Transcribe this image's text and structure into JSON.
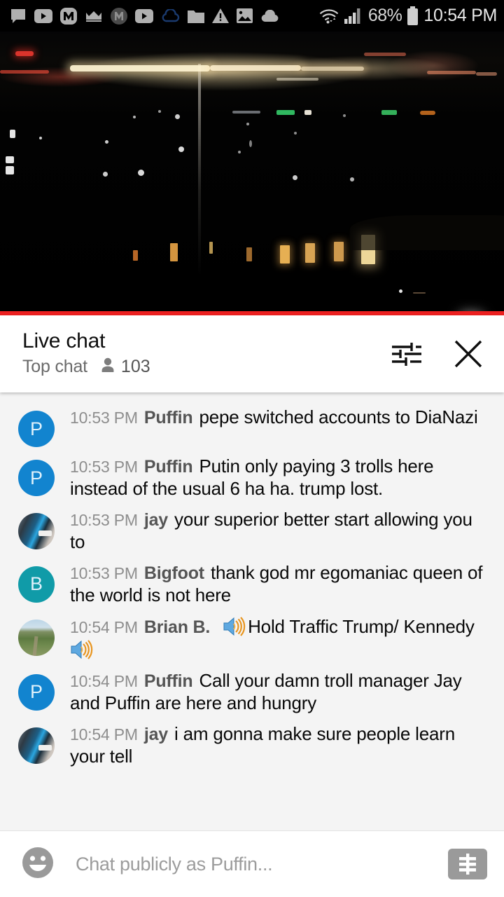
{
  "status_bar": {
    "icons": [
      {
        "name": "messages-icon"
      },
      {
        "name": "youtube-icon"
      },
      {
        "name": "m-badge-icon"
      },
      {
        "name": "crown-icon"
      },
      {
        "name": "m-circle-dark-icon"
      },
      {
        "name": "youtube-second-icon"
      },
      {
        "name": "cloud-outline-icon"
      },
      {
        "name": "folder-icon"
      },
      {
        "name": "warning-triangle-icon"
      },
      {
        "name": "image-icon"
      },
      {
        "name": "cloud-filled-icon"
      }
    ],
    "wifi_icon": "wifi-icon",
    "signal_icon": "cellular-signal-icon",
    "battery_percent": "68%",
    "battery_icon": "battery-icon",
    "clock": "10:54 PM"
  },
  "video": {
    "name": "live-video-player",
    "progress_percent": 100,
    "progress_color": "#ec2020"
  },
  "chat_header": {
    "title": "Live chat",
    "subtitle": "Top chat",
    "viewer_icon": "person-icon",
    "viewer_count": "103",
    "settings_icon": "tune-sliders-icon",
    "close_icon": "close-x-icon"
  },
  "messages": [
    {
      "avatar_type": "initial",
      "avatar_letter": "P",
      "avatar_color": "#1284cf",
      "timestamp": "10:53 PM",
      "author": "Puffin",
      "text": "pepe switched accounts to DiaNazi",
      "emoji": []
    },
    {
      "avatar_type": "initial",
      "avatar_letter": "P",
      "avatar_color": "#1284cf",
      "timestamp": "10:53 PM",
      "author": "Puffin",
      "text": "Putin only paying 3 trolls here instead of the usual 6 ha ha. trump lost.",
      "emoji": []
    },
    {
      "avatar_type": "photo-jay",
      "avatar_letter": "",
      "avatar_color": "#3a4a55",
      "timestamp": "10:53 PM",
      "author": "jay",
      "text": "your superior better start allowing you to",
      "emoji": []
    },
    {
      "avatar_type": "initial",
      "avatar_letter": "B",
      "avatar_color": "#109ba8",
      "timestamp": "10:53 PM",
      "author": "Bigfoot",
      "text": "thank god mr egomaniac queen of the world is not here",
      "emoji": []
    },
    {
      "avatar_type": "photo-brian",
      "avatar_letter": "",
      "avatar_color": "#7e9050",
      "timestamp": "10:54 PM",
      "author": "Brian B.",
      "text": "Hold Traffic Trump/ Kennedy",
      "emoji": [
        "loud-sound-emoji",
        "loud-sound-emoji"
      ],
      "text_before_emoji": "",
      "text_middle": "Hold Traffic Trump/ Kennedy"
    },
    {
      "avatar_type": "initial",
      "avatar_letter": "P",
      "avatar_color": "#1284cf",
      "timestamp": "10:54 PM",
      "author": "Puffin",
      "text": "Call your damn troll manager Jay and Puffin are here and hungry",
      "emoji": []
    },
    {
      "avatar_type": "photo-jay",
      "avatar_letter": "",
      "avatar_color": "#3a4a55",
      "timestamp": "10:54 PM",
      "author": "jay",
      "text": "i am gonna make sure people learn your tell",
      "emoji": []
    }
  ],
  "input_bar": {
    "emoji_button_icon": "emoji-smiley-icon",
    "placeholder": "Chat publicly as Puffin...",
    "value": "",
    "superchat_icon": "superchat-dollar-icon"
  }
}
